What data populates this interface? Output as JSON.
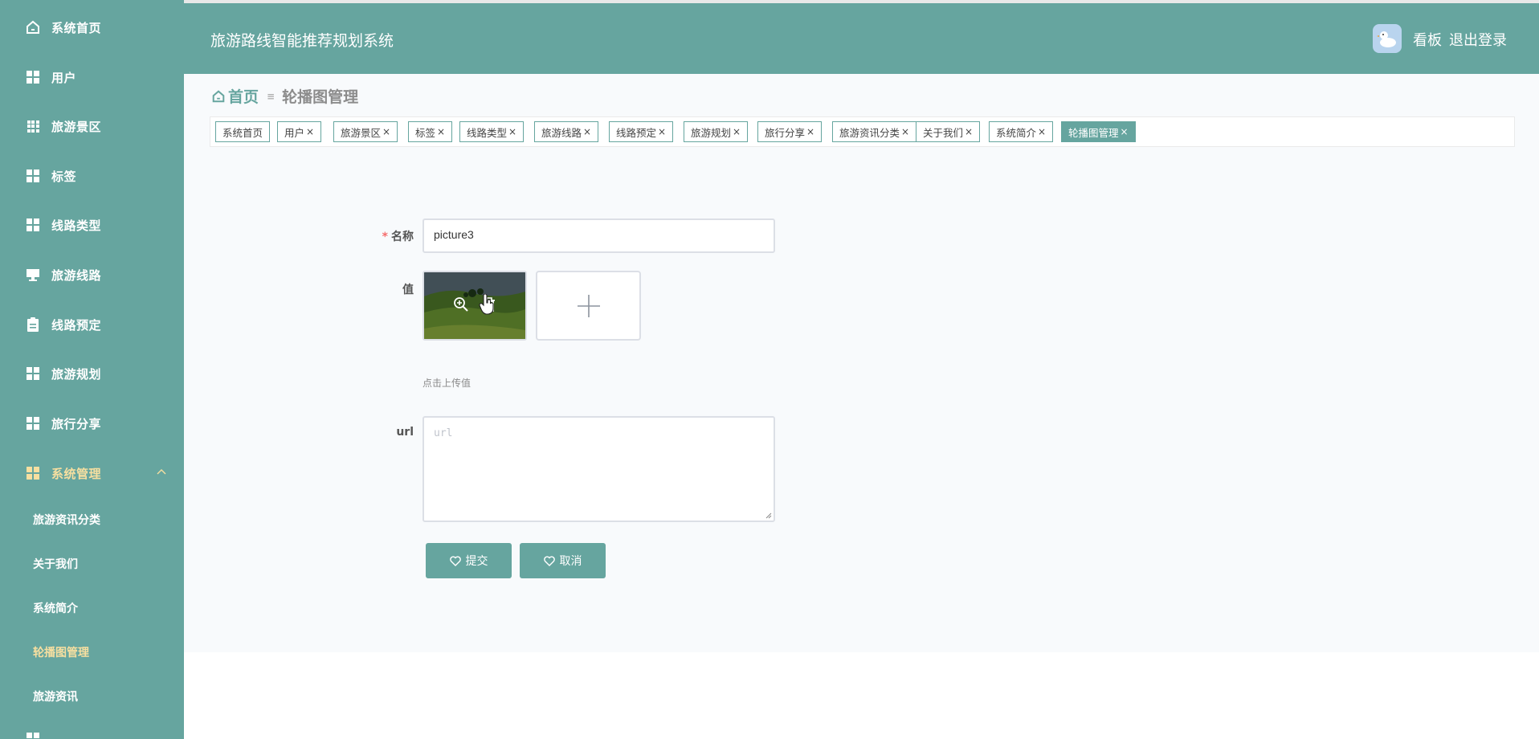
{
  "app": {
    "title": "旅游路线智能推荐规划系统",
    "kanban": "看板",
    "logout": "退出登录"
  },
  "sidebar": {
    "items": [
      {
        "label": "系统首页",
        "icon": "home-icon"
      },
      {
        "label": "用户",
        "icon": "grid-icon"
      },
      {
        "label": "旅游景区",
        "icon": "grid9-icon"
      },
      {
        "label": "标签",
        "icon": "grid-icon"
      },
      {
        "label": "线路类型",
        "icon": "grid-icon"
      },
      {
        "label": "旅游线路",
        "icon": "monitor-icon"
      },
      {
        "label": "线路预定",
        "icon": "clipboard-icon"
      },
      {
        "label": "旅游规划",
        "icon": "grid-icon"
      },
      {
        "label": "旅行分享",
        "icon": "grid-icon"
      },
      {
        "label": "系统管理",
        "icon": "grid-icon",
        "expanded": true
      }
    ],
    "subitems": [
      {
        "label": "旅游资讯分类"
      },
      {
        "label": "关于我们"
      },
      {
        "label": "系统简介"
      },
      {
        "label": "轮播图管理",
        "active": true
      },
      {
        "label": "旅游资讯"
      }
    ]
  },
  "breadcrumb": {
    "home": "首页",
    "current": "轮播图管理"
  },
  "tags": [
    {
      "label": "系统首页",
      "closable": false
    },
    {
      "label": "用户",
      "closable": true
    },
    {
      "label": "旅游景区",
      "closable": true
    },
    {
      "label": "标签",
      "closable": true
    },
    {
      "label": "线路类型",
      "closable": true
    },
    {
      "label": "旅游线路",
      "closable": true
    },
    {
      "label": "线路预定",
      "closable": true
    },
    {
      "label": "旅游规划",
      "closable": true
    },
    {
      "label": "旅行分享",
      "closable": true
    },
    {
      "label": "旅游资讯分类",
      "closable": true
    },
    {
      "label": "关于我们",
      "closable": true
    },
    {
      "label": "系统简介",
      "closable": true
    },
    {
      "label": "轮播图管理",
      "closable": true,
      "active": true
    }
  ],
  "form": {
    "name_label": "名称",
    "name_value": "picture3",
    "value_label": "值",
    "upload_hint": "点击上传值",
    "url_label": "url",
    "url_placeholder": "url",
    "submit": "提交",
    "cancel": "取消"
  },
  "colors": {
    "primary": "#66a59f",
    "active_text": "#f7dfa0",
    "required": "#f56c6c"
  }
}
